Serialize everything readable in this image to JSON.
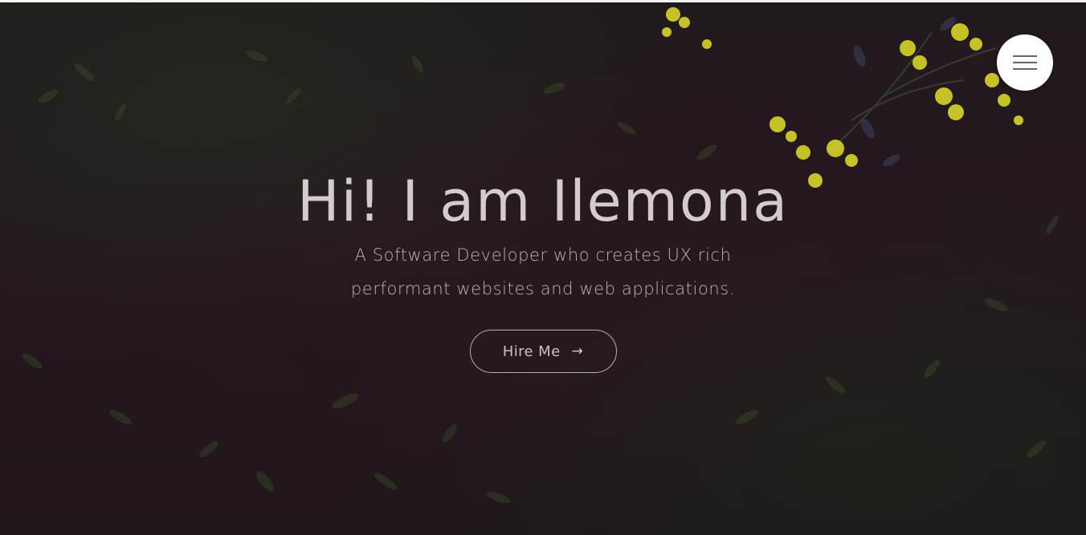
{
  "hero": {
    "title": "Hi! I am Ilemona",
    "subtitle": "A Software Developer who creates UX rich performant websites and web applications.",
    "hire_button_label": "Hire Me",
    "hire_button_arrow": "→"
  },
  "nav": {
    "menu_icon": "hamburger-menu-icon"
  },
  "colors": {
    "background": "#1e1519",
    "title_text": "#d2cccf",
    "subtitle_text": "#b9b3b6",
    "button_border": "#b5aeb2",
    "menu_button_bg": "#ffffff",
    "flower_yellow": "#d8d52a"
  }
}
